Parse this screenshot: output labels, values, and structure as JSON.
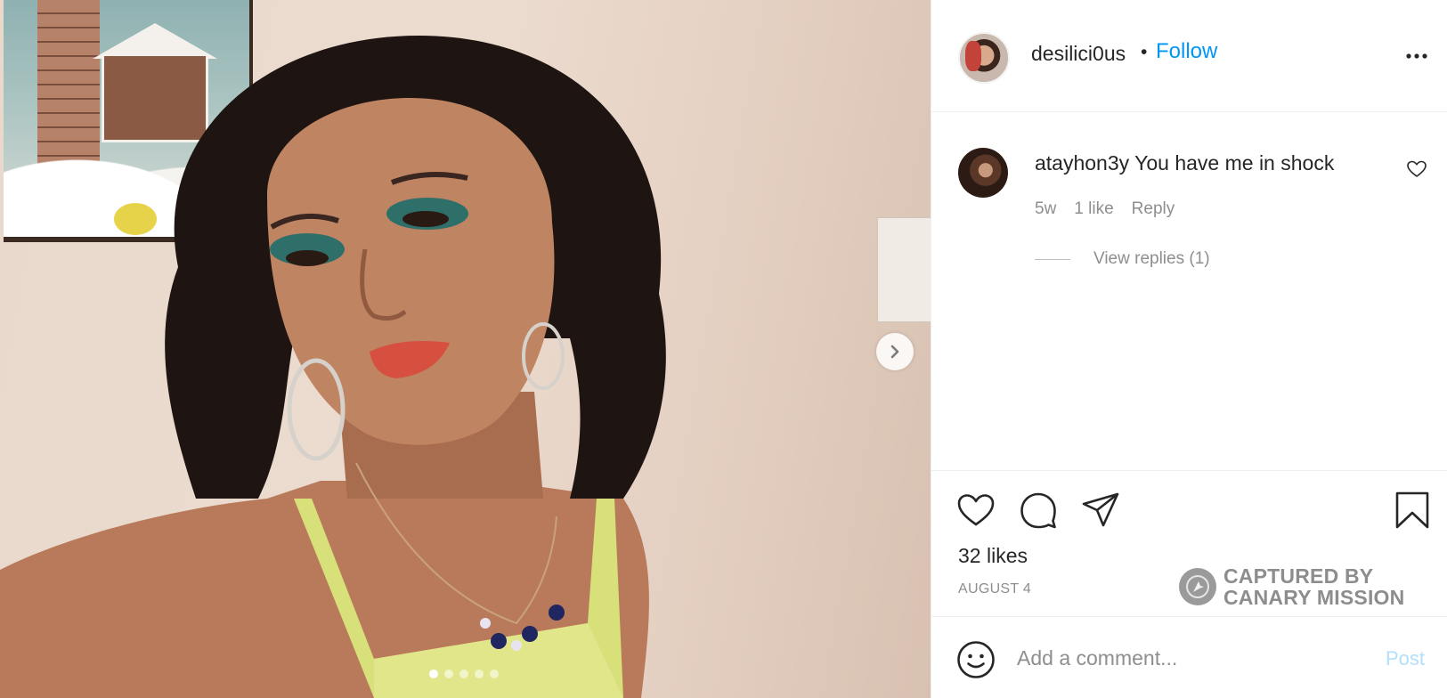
{
  "post": {
    "owner": {
      "username": "desilici0us",
      "separator": "•",
      "follow_label": "Follow"
    },
    "comments": [
      {
        "username": "atayhon3y",
        "text": "You have me in shock",
        "age": "5w",
        "likes_label": "1 like",
        "reply_label": "Reply",
        "view_replies_label": "View replies (1)"
      }
    ],
    "likes_label": "32 likes",
    "date_label": "AUGUST 4",
    "carousel": {
      "total_slides": 5,
      "active_slide": 1
    },
    "add_comment": {
      "placeholder": "Add a comment...",
      "post_label": "Post"
    }
  },
  "watermark": {
    "line1": "CAPTURED BY",
    "line2": "CANARY MISSION"
  },
  "icons": {
    "more": "more-options-icon",
    "like": "heart-icon",
    "comment": "comment-icon",
    "share": "share-icon",
    "save": "bookmark-icon",
    "emoji": "emoji-icon",
    "next": "chevron-right-icon"
  },
  "colors": {
    "follow_blue": "#0095f6",
    "post_disabled": "#b2dffc",
    "secondary_text": "#8e8e8e"
  }
}
